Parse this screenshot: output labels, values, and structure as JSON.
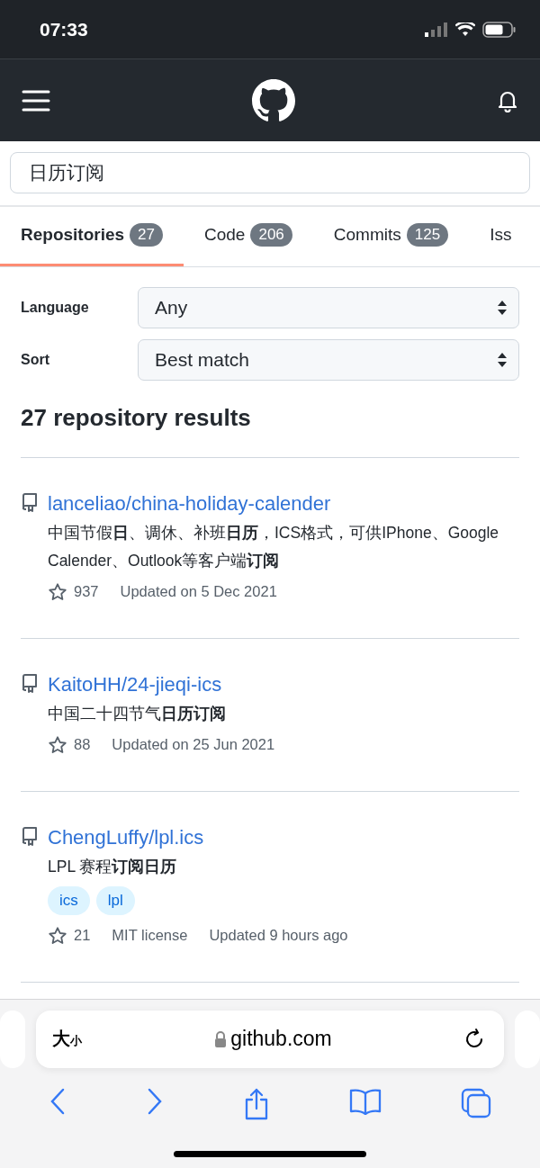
{
  "status_bar": {
    "time": "07:33"
  },
  "search": {
    "value": "日历订阅"
  },
  "tabs": [
    {
      "label": "Repositories",
      "count": "27",
      "selected": true
    },
    {
      "label": "Code",
      "count": "206",
      "selected": false
    },
    {
      "label": "Commits",
      "count": "125",
      "selected": false
    },
    {
      "label": "Iss",
      "selected": false
    }
  ],
  "filters": [
    {
      "label": "Language",
      "value": "Any"
    },
    {
      "label": "Sort",
      "value": "Best match"
    }
  ],
  "results_heading": "27 repository results",
  "repositories": [
    {
      "name": "lanceliao/china-holiday-calender",
      "description": "中国节假**日**、调休、补班**日历**，ICS格式，可供IPhone、Google Calender、Outlook等客户端**订阅**",
      "stars": "937",
      "updated": "Updated on 5 Dec 2021"
    },
    {
      "name": "KaitoHH/24-jieqi-ics",
      "description": "中国二十四节气**日历订阅**",
      "stars": "88",
      "updated": "Updated on 25 Jun 2021"
    },
    {
      "name": "ChengLuffy/lpl.ics",
      "description": "LPL 赛程**订阅日历**",
      "topics": [
        "ics",
        "lpl"
      ],
      "stars": "21",
      "license": "MIT license",
      "updated": "Updated 9 hours ago"
    }
  ],
  "browser": {
    "text_size": [
      "大",
      "小"
    ],
    "url": "github.com"
  }
}
